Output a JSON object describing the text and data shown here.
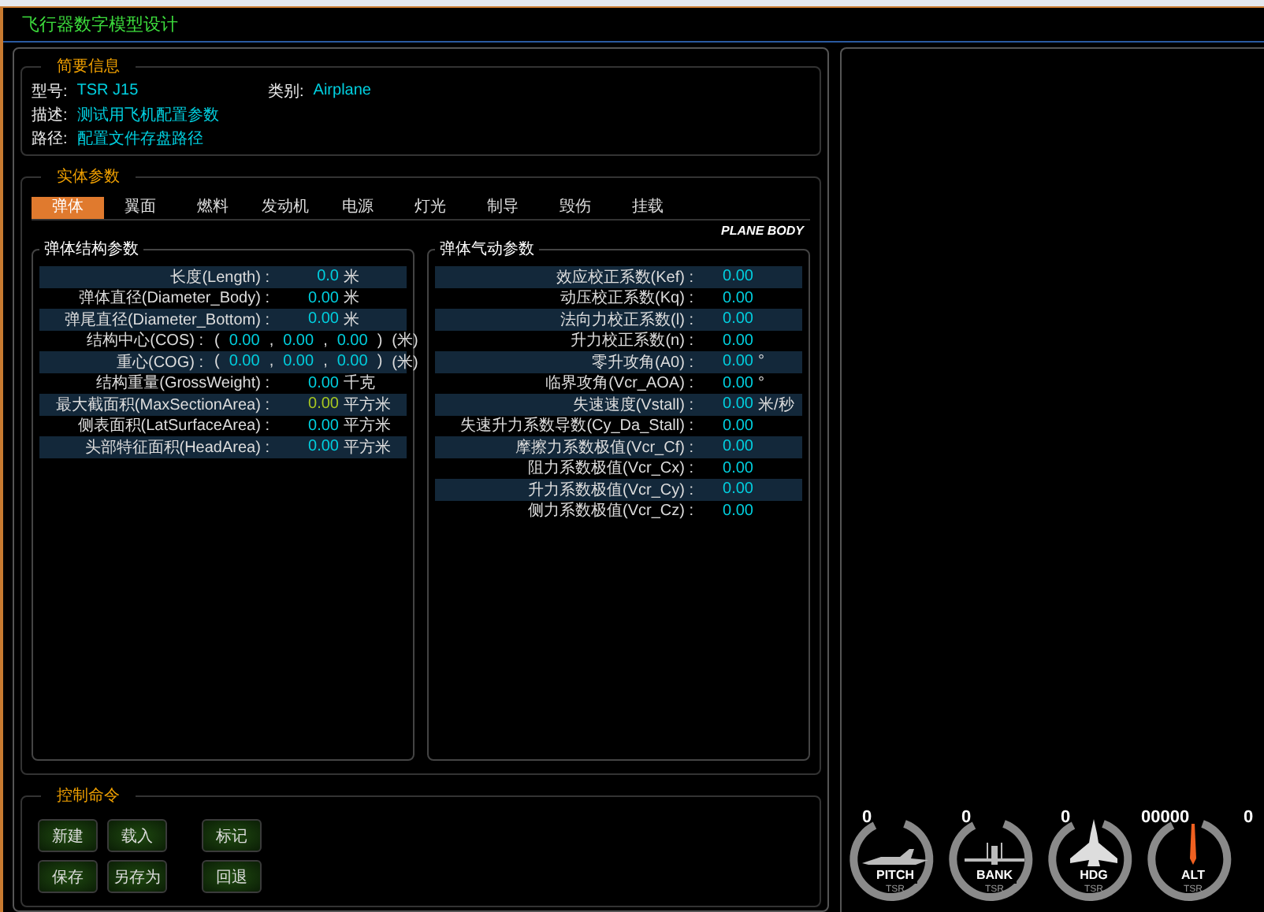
{
  "window": {
    "title": "飞行器数字模型设计"
  },
  "summary": {
    "title": "简要信息",
    "fields": [
      {
        "label": "型号:",
        "value": "TSR J15"
      },
      {
        "label": "类别:",
        "value": "Airplane"
      },
      {
        "label": "描述:",
        "value": "测试用飞机配置参数"
      },
      {
        "label": "路径:",
        "value": "配置文件存盘路径"
      }
    ]
  },
  "entity": {
    "title": "实体参数",
    "tabs": [
      {
        "label": "弹体",
        "selected": true
      },
      {
        "label": "翼面",
        "selected": false
      },
      {
        "label": "燃料",
        "selected": false
      },
      {
        "label": "发动机",
        "selected": false
      },
      {
        "label": "电源",
        "selected": false
      },
      {
        "label": "灯光",
        "selected": false
      },
      {
        "label": "制导",
        "selected": false
      },
      {
        "label": "毁伤",
        "selected": false
      },
      {
        "label": "挂载",
        "selected": false
      }
    ],
    "badge": "PLANE BODY",
    "structure": {
      "title": "弹体结构参数",
      "rows": [
        {
          "kind": "scalar",
          "label": "长度(Length) :",
          "value": "0.0",
          "unit": "米",
          "highlighted": false
        },
        {
          "kind": "scalar",
          "label": "弹体直径(Diameter_Body) :",
          "value": "0.00",
          "unit": "米",
          "highlighted": false
        },
        {
          "kind": "scalar",
          "label": "弹尾直径(Diameter_Bottom) :",
          "value": "0.00",
          "unit": "米",
          "highlighted": false
        },
        {
          "kind": "vector",
          "label": "结构中心(COS) :",
          "open": "(",
          "values": [
            "0.00",
            "0.00",
            "0.00"
          ],
          "separator": ",",
          "close": ")",
          "unit": "(米)"
        },
        {
          "kind": "vector",
          "label": "重心(COG) :",
          "open": "(",
          "values": [
            "0.00",
            "0.00",
            "0.00"
          ],
          "separator": ",",
          "close": ")",
          "unit": "(米)"
        },
        {
          "kind": "scalar",
          "label": "结构重量(GrossWeight) :",
          "value": "0.00",
          "unit": "千克",
          "highlighted": false
        },
        {
          "kind": "scalar",
          "label": "最大截面积(MaxSectionArea) :",
          "value": "0.00",
          "unit": "平方米",
          "highlighted": true
        },
        {
          "kind": "scalar",
          "label": "侧表面积(LatSurfaceArea) :",
          "value": "0.00",
          "unit": "平方米",
          "highlighted": false
        },
        {
          "kind": "scalar",
          "label": "头部特征面积(HeadArea) :",
          "value": "0.00",
          "unit": "平方米",
          "highlighted": false
        }
      ]
    },
    "aero": {
      "title": "弹体气动参数",
      "rows": [
        {
          "label": "效应校正系数(Kef) :",
          "value": "0.00"
        },
        {
          "label": "动压校正系数(Kq) :",
          "value": "0.00"
        },
        {
          "label": "法向力校正系数(l) :",
          "value": "0.00"
        },
        {
          "label": "升力校正系数(n) :",
          "value": "0.00"
        },
        {
          "label": "零升攻角(A0) :",
          "value": "0.00",
          "unit": "°"
        },
        {
          "label": "临界攻角(Vcr_AOA) :",
          "value": "0.00",
          "unit": "°"
        },
        {
          "label": "失速速度(Vstall) :",
          "value": "0.00",
          "unit": "米/秒"
        },
        {
          "label": "失速升力系数导数(Cy_Da_Stall) :",
          "value": "0.00"
        },
        {
          "label": "摩擦力系数极值(Vcr_Cf) :",
          "value": "0.00"
        },
        {
          "label": "阻力系数极值(Vcr_Cx) :",
          "value": "0.00"
        },
        {
          "label": "升力系数极值(Vcr_Cy) :",
          "value": "0.00"
        },
        {
          "label": "侧力系数极值(Vcr_Cz) :",
          "value": "0.00"
        }
      ]
    }
  },
  "controls": {
    "title": "控制命令",
    "buttons": [
      [
        "新建",
        "载入",
        "标记"
      ],
      [
        "保存",
        "另存为",
        "回退"
      ]
    ]
  },
  "gauges": [
    {
      "kind": "pitch",
      "value": "0",
      "label": "PITCH",
      "sub": "TSR"
    },
    {
      "kind": "bank",
      "value": "0",
      "label": "BANK",
      "sub": "TSR"
    },
    {
      "kind": "heading",
      "value": "0",
      "label": "HDG",
      "sub": "TSR"
    },
    {
      "kind": "altitude",
      "value": "00000",
      "label": "ALT",
      "sub": "TSR"
    },
    {
      "kind": "partial",
      "value": "0"
    }
  ]
}
